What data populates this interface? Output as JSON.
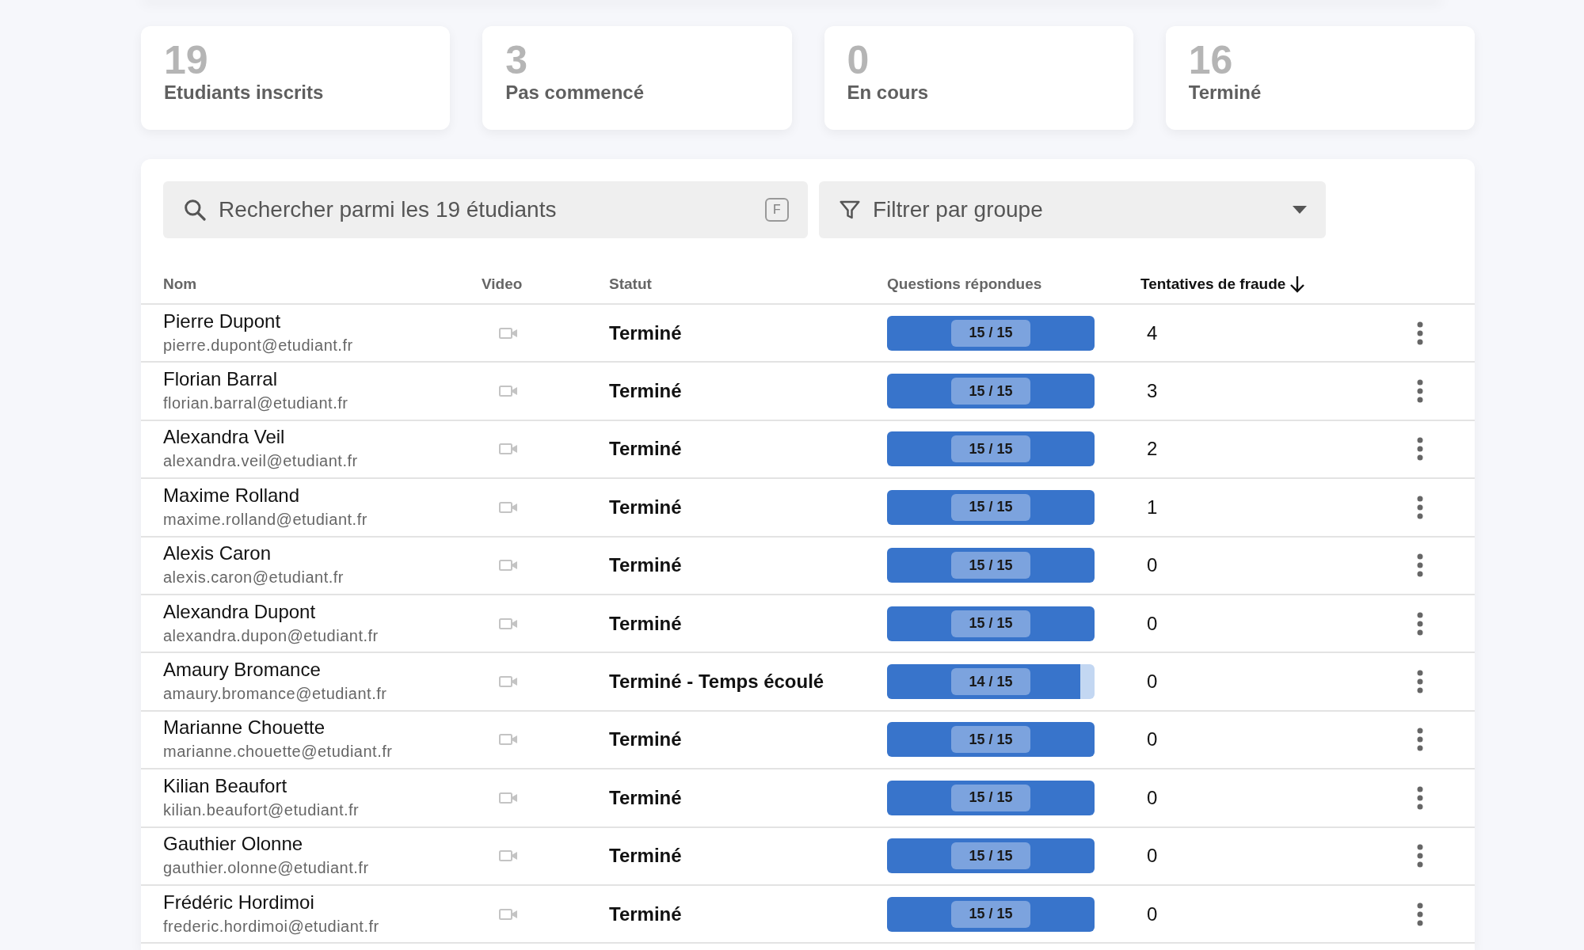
{
  "stats": [
    {
      "value": "19",
      "label": "Etudiants inscrits"
    },
    {
      "value": "3",
      "label": "Pas commencé"
    },
    {
      "value": "0",
      "label": "En cours"
    },
    {
      "value": "16",
      "label": "Terminé"
    }
  ],
  "search": {
    "placeholder": "Rechercher parmi les 19 étudiants",
    "shortcut": "F"
  },
  "filter": {
    "placeholder": "Filtrer par groupe"
  },
  "table": {
    "columns": [
      {
        "label": "Nom",
        "sorted": false
      },
      {
        "label": "Video",
        "sorted": false
      },
      {
        "label": "Statut",
        "sorted": false
      },
      {
        "label": "Questions répondues",
        "sorted": false
      },
      {
        "label": "Tentatives de fraude",
        "sorted": true
      }
    ],
    "rows": [
      {
        "name": "Pierre Dupont",
        "email": "pierre.dupont@etudiant.fr",
        "status": "Terminé",
        "answered": "15 / 15",
        "level": 1,
        "fraud": "4"
      },
      {
        "name": "Florian Barral",
        "email": "florian.barral@etudiant.fr",
        "status": "Terminé",
        "answered": "15 / 15",
        "level": 1,
        "fraud": "3"
      },
      {
        "name": "Alexandra Veil",
        "email": "alexandra.veil@etudiant.fr",
        "status": "Terminé",
        "answered": "15 / 15",
        "level": 1,
        "fraud": "2"
      },
      {
        "name": "Maxime Rolland",
        "email": "maxime.rolland@etudiant.fr",
        "status": "Terminé",
        "answered": "15 / 15",
        "level": 1,
        "fraud": "1"
      },
      {
        "name": "Alexis Caron",
        "email": "alexis.caron@etudiant.fr",
        "status": "Terminé",
        "answered": "15 / 15",
        "level": 1,
        "fraud": "0"
      },
      {
        "name": "Alexandra Dupont",
        "email": "alexandra.dupon@etudiant.fr",
        "status": "Terminé",
        "answered": "15 / 15",
        "level": 1,
        "fraud": "0"
      },
      {
        "name": "Amaury Bromance",
        "email": "amaury.bromance@etudiant.fr",
        "status": "Terminé - Temps écoulé",
        "answered": "14 / 15",
        "level": 0.933,
        "fraud": "0"
      },
      {
        "name": "Marianne Chouette",
        "email": "marianne.chouette@etudiant.fr",
        "status": "Terminé",
        "answered": "15 / 15",
        "level": 1,
        "fraud": "0"
      },
      {
        "name": "Kilian Beaufort",
        "email": "kilian.beaufort@etudiant.fr",
        "status": "Terminé",
        "answered": "15 / 15",
        "level": 1,
        "fraud": "0"
      },
      {
        "name": "Gauthier Olonne",
        "email": "gauthier.olonne@etudiant.fr",
        "status": "Terminé",
        "answered": "15 / 15",
        "level": 1,
        "fraud": "0"
      },
      {
        "name": "Frédéric Hordimoi",
        "email": "frederic.hordimoi@etudiant.fr",
        "status": "Terminé",
        "answered": "15 / 15",
        "level": 1,
        "fraud": "0"
      }
    ]
  }
}
